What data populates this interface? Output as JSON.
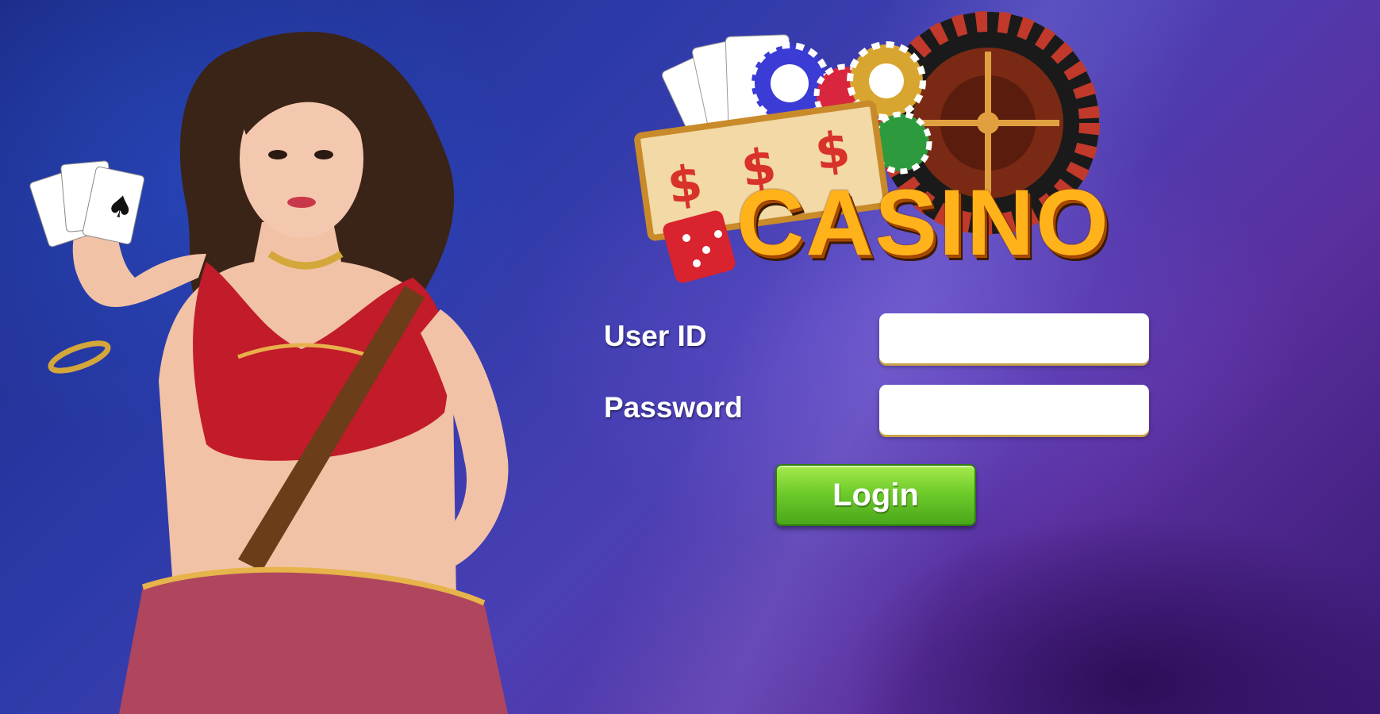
{
  "logo": {
    "text": "CASINO"
  },
  "form": {
    "user_id_label": "User ID",
    "user_id_value": "",
    "password_label": "Password",
    "password_value": "",
    "login_label": "Login"
  },
  "colors": {
    "background": "#2a3aa8",
    "accent_gold": "#ffb21a",
    "login_green": "#6fcc2b"
  }
}
